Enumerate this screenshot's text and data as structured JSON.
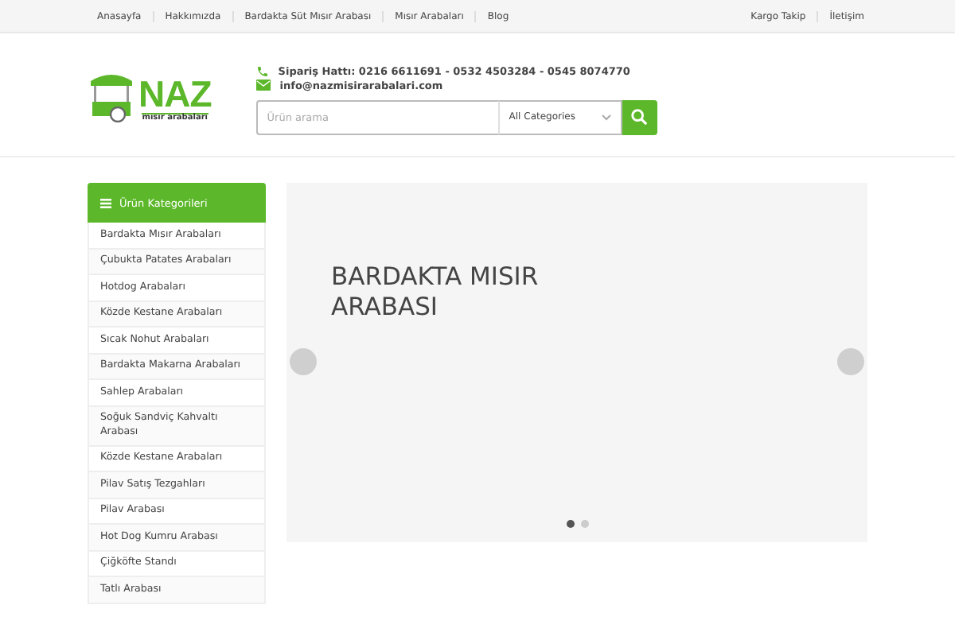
{
  "top_nav": {
    "left": [
      "Anasayfa",
      "Hakkımızda",
      "Bardakta Süt Mısır Arabası",
      "Mısır Arabaları",
      "Blog"
    ],
    "right": [
      "Kargo Takip",
      "İletişim"
    ]
  },
  "logo": {
    "title": "NAZ",
    "subtitle": "mısır arabaları"
  },
  "contact": {
    "phone": "Sipariş Hattı: 0216 6611691 - 0532 4503284 - 0545 8074770",
    "email": "info@nazmisirarabalari.com"
  },
  "search": {
    "placeholder": "Ürün arama",
    "category": "All Categories"
  },
  "sidebar": {
    "title": "Ürün Kategorileri",
    "items": [
      "Bardakta Mısır Arabaları",
      "Çubukta Patates Arabaları",
      "Hotdog Arabaları",
      "Közde Kestane Arabaları",
      "Sıcak Nohut Arabaları",
      "Bardakta Makarna Arabaları",
      "Sahlep Arabaları",
      "Soğuk Sandviç Kahvaltı Arabası",
      "Közde Kestane Arabaları",
      "Pilav Satış Tezgahları",
      "Pilav Arabası",
      "Hot Dog Kumru Arabası",
      "Çiğköfte Standı",
      "Tatlı Arabası"
    ]
  },
  "slider": {
    "heading": "BARDAKTA MISIR ARABASI",
    "dots": [
      {
        "selected": true
      },
      {
        "selected": false
      }
    ]
  }
}
